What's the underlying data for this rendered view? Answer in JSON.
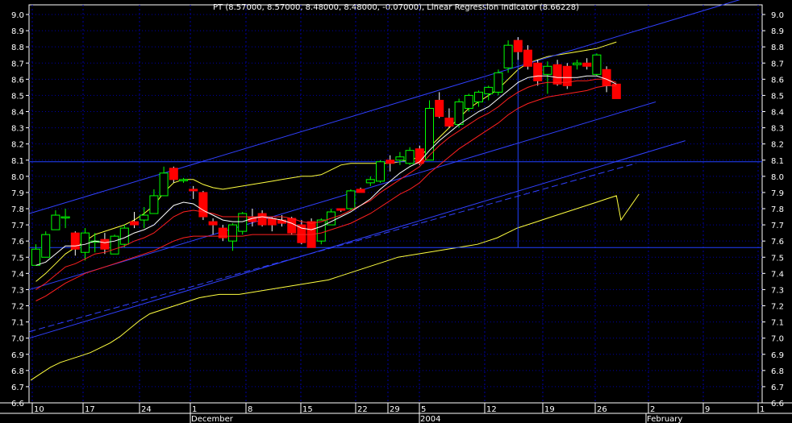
{
  "chart_data": {
    "type": "candlestick",
    "title": "PT (8.57000, 8.57000, 8.48000, 8.48000, -0.07000), Linear Regression Indicator (8.66228)",
    "ylim": [
      6.6,
      9.0
    ],
    "y_ticks": [
      "9.0",
      "8.9",
      "8.8",
      "8.7",
      "8.6",
      "8.5",
      "8.4",
      "8.3",
      "8.2",
      "8.1",
      "8.0",
      "7.9",
      "7.8",
      "7.7",
      "7.6",
      "7.5",
      "7.4",
      "7.3",
      "7.2",
      "7.1",
      "7.0",
      "6.9",
      "6.8",
      "6.7",
      "6.6"
    ],
    "x_ticks": [
      "10",
      "17",
      "24",
      "1",
      "8",
      "15",
      "22",
      "29",
      "5",
      "12",
      "19",
      "26",
      "2",
      "9",
      "1"
    ],
    "x_months": [
      "December",
      "2004",
      "February"
    ],
    "grid": true,
    "candles": [
      {
        "o": 7.45,
        "h": 7.58,
        "l": 7.45,
        "c": 7.55
      },
      {
        "o": 7.5,
        "h": 7.66,
        "l": 7.5,
        "c": 7.64
      },
      {
        "o": 7.67,
        "h": 7.79,
        "l": 7.67,
        "c": 7.76
      },
      {
        "o": 7.75,
        "h": 7.8,
        "l": 7.68,
        "c": 7.75
      },
      {
        "o": 7.65,
        "h": 7.66,
        "l": 7.51,
        "c": 7.55
      },
      {
        "o": 7.53,
        "h": 7.68,
        "l": 7.48,
        "c": 7.65
      },
      {
        "o": 7.6,
        "h": 7.65,
        "l": 7.53,
        "c": 7.6
      },
      {
        "o": 7.61,
        "h": 7.65,
        "l": 7.52,
        "c": 7.55
      },
      {
        "o": 7.52,
        "h": 7.64,
        "l": 7.52,
        "c": 7.63
      },
      {
        "o": 7.58,
        "h": 7.7,
        "l": 7.56,
        "c": 7.68
      },
      {
        "o": 7.72,
        "h": 7.78,
        "l": 7.68,
        "c": 7.7
      },
      {
        "o": 7.73,
        "h": 7.81,
        "l": 7.68,
        "c": 7.76
      },
      {
        "o": 7.77,
        "h": 7.92,
        "l": 7.77,
        "c": 7.88
      },
      {
        "o": 7.88,
        "h": 8.06,
        "l": 7.88,
        "c": 8.02
      },
      {
        "o": 8.05,
        "h": 8.06,
        "l": 7.96,
        "c": 7.98
      },
      {
        "o": 7.98,
        "h": 7.99,
        "l": 7.96,
        "c": 7.98
      },
      {
        "o": 7.92,
        "h": 7.94,
        "l": 7.86,
        "c": 7.91
      },
      {
        "o": 7.9,
        "h": 7.91,
        "l": 7.73,
        "c": 7.75
      },
      {
        "o": 7.72,
        "h": 7.74,
        "l": 7.64,
        "c": 7.7
      },
      {
        "o": 7.68,
        "h": 7.7,
        "l": 7.6,
        "c": 7.62
      },
      {
        "o": 7.6,
        "h": 7.71,
        "l": 7.54,
        "c": 7.7
      },
      {
        "o": 7.66,
        "h": 7.78,
        "l": 7.64,
        "c": 7.77
      },
      {
        "o": 7.75,
        "h": 7.8,
        "l": 7.69,
        "c": 7.72
      },
      {
        "o": 7.77,
        "h": 7.79,
        "l": 7.69,
        "c": 7.7
      },
      {
        "o": 7.74,
        "h": 7.75,
        "l": 7.66,
        "c": 7.7
      },
      {
        "o": 7.73,
        "h": 7.76,
        "l": 7.69,
        "c": 7.71
      },
      {
        "o": 7.74,
        "h": 7.75,
        "l": 7.64,
        "c": 7.65
      },
      {
        "o": 7.7,
        "h": 7.73,
        "l": 7.58,
        "c": 7.59
      },
      {
        "o": 7.72,
        "h": 7.74,
        "l": 7.56,
        "c": 7.56
      },
      {
        "o": 7.6,
        "h": 7.74,
        "l": 7.58,
        "c": 7.73
      },
      {
        "o": 7.7,
        "h": 7.8,
        "l": 7.7,
        "c": 7.78
      },
      {
        "o": 7.8,
        "h": 7.8,
        "l": 7.78,
        "c": 7.79
      },
      {
        "o": 7.8,
        "h": 7.92,
        "l": 7.79,
        "c": 7.91
      },
      {
        "o": 7.92,
        "h": 7.93,
        "l": 7.9,
        "c": 7.9
      },
      {
        "o": 7.96,
        "h": 8.0,
        "l": 7.94,
        "c": 7.98
      },
      {
        "o": 7.97,
        "h": 8.1,
        "l": 7.96,
        "c": 8.09
      },
      {
        "o": 8.1,
        "h": 8.13,
        "l": 8.03,
        "c": 8.08
      },
      {
        "o": 8.1,
        "h": 8.15,
        "l": 8.07,
        "c": 8.12
      },
      {
        "o": 8.08,
        "h": 8.18,
        "l": 8.07,
        "c": 8.16
      },
      {
        "o": 8.17,
        "h": 8.19,
        "l": 8.07,
        "c": 8.08
      },
      {
        "o": 8.1,
        "h": 8.47,
        "l": 8.1,
        "c": 8.42
      },
      {
        "o": 8.47,
        "h": 8.52,
        "l": 8.36,
        "c": 8.37
      },
      {
        "o": 8.36,
        "h": 8.42,
        "l": 8.3,
        "c": 8.31
      },
      {
        "o": 8.32,
        "h": 8.48,
        "l": 8.3,
        "c": 8.46
      },
      {
        "o": 8.42,
        "h": 8.51,
        "l": 8.4,
        "c": 8.5
      },
      {
        "o": 8.46,
        "h": 8.53,
        "l": 8.43,
        "c": 8.52
      },
      {
        "o": 8.51,
        "h": 8.56,
        "l": 8.47,
        "c": 8.55
      },
      {
        "o": 8.52,
        "h": 8.66,
        "l": 8.5,
        "c": 8.64
      },
      {
        "o": 8.67,
        "h": 8.84,
        "l": 8.64,
        "c": 8.81
      },
      {
        "o": 8.84,
        "h": 8.86,
        "l": 8.72,
        "c": 8.77
      },
      {
        "o": 8.78,
        "h": 8.81,
        "l": 8.66,
        "c": 8.68
      },
      {
        "o": 8.7,
        "h": 8.72,
        "l": 8.56,
        "c": 8.59
      },
      {
        "o": 8.63,
        "h": 8.71,
        "l": 8.51,
        "c": 8.68
      },
      {
        "o": 8.69,
        "h": 8.72,
        "l": 8.56,
        "c": 8.57
      },
      {
        "o": 8.68,
        "h": 8.7,
        "l": 8.54,
        "c": 8.56
      },
      {
        "o": 8.69,
        "h": 8.72,
        "l": 8.66,
        "c": 8.7
      },
      {
        "o": 8.7,
        "h": 8.73,
        "l": 8.66,
        "c": 8.68
      },
      {
        "o": 8.63,
        "h": 8.76,
        "l": 8.62,
        "c": 8.75
      },
      {
        "o": 8.66,
        "h": 8.68,
        "l": 8.52,
        "c": 8.56
      },
      {
        "o": 8.57,
        "h": 8.57,
        "l": 8.48,
        "c": 8.48
      }
    ],
    "lines": {
      "white": [
        7.45,
        7.47,
        7.52,
        7.57,
        7.57,
        7.58,
        7.6,
        7.59,
        7.6,
        7.62,
        7.65,
        7.67,
        7.7,
        7.76,
        7.82,
        7.84,
        7.83,
        7.79,
        7.76,
        7.73,
        7.72,
        7.72,
        7.74,
        7.75,
        7.74,
        7.73,
        7.71,
        7.68,
        7.67,
        7.69,
        7.72,
        7.75,
        7.78,
        7.82,
        7.86,
        7.92,
        7.97,
        8.02,
        8.06,
        8.09,
        8.16,
        8.22,
        8.27,
        8.32,
        8.36,
        8.4,
        8.43,
        8.48,
        8.53,
        8.58,
        8.61,
        8.62,
        8.62,
        8.61,
        8.61,
        8.61,
        8.62,
        8.62,
        8.6,
        8.57
      ],
      "red_inner": [
        7.3,
        7.34,
        7.39,
        7.44,
        7.46,
        7.49,
        7.52,
        7.53,
        7.55,
        7.57,
        7.6,
        7.62,
        7.65,
        7.7,
        7.75,
        7.78,
        7.79,
        7.78,
        7.77,
        7.75,
        7.75,
        7.75,
        7.75,
        7.75,
        7.75,
        7.75,
        7.74,
        7.72,
        7.71,
        7.72,
        7.74,
        7.76,
        7.79,
        7.82,
        7.85,
        7.9,
        7.94,
        7.98,
        8.02,
        8.06,
        8.13,
        8.19,
        8.24,
        8.28,
        8.32,
        8.36,
        8.39,
        8.43,
        8.48,
        8.52,
        8.55,
        8.57,
        8.58,
        8.58,
        8.58,
        8.59,
        8.59,
        8.6,
        8.6,
        8.58
      ],
      "red_outer": [
        7.23,
        7.26,
        7.3,
        7.34,
        7.37,
        7.4,
        7.42,
        7.44,
        7.46,
        7.48,
        7.5,
        7.52,
        7.54,
        7.57,
        7.6,
        7.62,
        7.63,
        7.63,
        7.63,
        7.63,
        7.63,
        7.63,
        7.64,
        7.64,
        7.64,
        7.64,
        7.64,
        7.64,
        7.64,
        7.65,
        7.67,
        7.69,
        7.71,
        7.74,
        7.77,
        7.81,
        7.85,
        7.89,
        7.92,
        7.96,
        8.02,
        8.07,
        8.12,
        8.17,
        8.21,
        8.25,
        8.29,
        8.33,
        8.38,
        8.42,
        8.45,
        8.47,
        8.49,
        8.5,
        8.51,
        8.52,
        8.53,
        8.55,
        8.56,
        8.56
      ],
      "yellow_upper": [
        7.35,
        7.4,
        7.46,
        7.52,
        7.56,
        7.6,
        7.64,
        7.66,
        7.68,
        7.7,
        7.73,
        7.77,
        7.82,
        7.9,
        7.96,
        7.98,
        7.98,
        7.95,
        7.93,
        7.92,
        7.93,
        7.94,
        7.95,
        7.96,
        7.97,
        7.98,
        7.99,
        8.0,
        8.0,
        8.01,
        8.04,
        8.07,
        8.08,
        8.08,
        8.08,
        8.08,
        8.08,
        8.09,
        8.1,
        8.12,
        8.18,
        8.24,
        8.3,
        8.36,
        8.42,
        8.46,
        8.5,
        8.54,
        8.6,
        8.66,
        8.7,
        8.72,
        8.74,
        8.75,
        8.76,
        8.77,
        8.78,
        8.79,
        8.81,
        8.83
      ],
      "yellow_lower": [
        6.74,
        6.78,
        6.82,
        6.85,
        6.87,
        6.89,
        6.91,
        6.94,
        6.97,
        7.01,
        7.06,
        7.11,
        7.15,
        7.17,
        7.19,
        7.21,
        7.23,
        7.25,
        7.26,
        7.27,
        7.27,
        7.27,
        7.28,
        7.29,
        7.3,
        7.31,
        7.32,
        7.33,
        7.34,
        7.35,
        7.36,
        7.38,
        7.4,
        7.42,
        7.44,
        7.46,
        7.48,
        7.5,
        7.51,
        7.52,
        7.53,
        7.54,
        7.55,
        7.56,
        7.57,
        7.58,
        7.6,
        7.62,
        7.65,
        7.68,
        7.7,
        7.72,
        7.74,
        7.76,
        7.78,
        7.8,
        7.82,
        7.84,
        7.86,
        7.88
      ]
    },
    "lines_extra": {
      "yellow_lower_trail": [
        7.73,
        7.77,
        7.81,
        7.85,
        7.89
      ]
    },
    "hlines": [
      8.09,
      7.56
    ],
    "vline_x_index": 49,
    "regression_channels": [
      {
        "from": [
          0,
          7.77
        ],
        "to": [
          72,
          9.1
        ],
        "style": "solid"
      },
      {
        "from": [
          0,
          7.3
        ],
        "to": [
          63,
          8.46
        ],
        "style": "solid"
      },
      {
        "from": [
          0,
          7.0
        ],
        "to": [
          66,
          8.22
        ],
        "style": "solid"
      },
      {
        "from": [
          0,
          7.04
        ],
        "to": [
          61,
          8.08
        ],
        "style": "dashed"
      }
    ],
    "colors": {
      "background": "#000000",
      "grid": "#0000a8",
      "axis_text": "#ffffff",
      "up_candle": "#00ff00",
      "down_candle": "#ff0000",
      "ma_white": "#ffffff",
      "ma_red": "#ff2020",
      "band_yellow": "#ffff40",
      "channel_blue": "#2040ff",
      "regression_blue": "#3040ff"
    }
  }
}
